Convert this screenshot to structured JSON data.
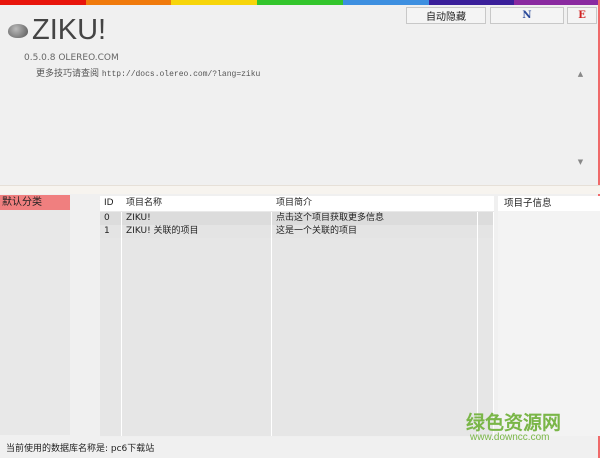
{
  "colors": {
    "rainbow": [
      "#e8150c",
      "#f07a0c",
      "#f7d50a",
      "#33c52c",
      "#3d8fe0",
      "#3a1f9a",
      "#8a2aa0"
    ],
    "accent": "#f07f7f"
  },
  "toolbar": {
    "auto_hide": "自动隐藏",
    "n": "N",
    "e": "E"
  },
  "header": {
    "title": "ZIKU!",
    "version": "0.5.0.8  OLEREO.COM",
    "more_label": "更多技巧请查阅",
    "more_url": "http://docs.olereo.com/?lang=ziku"
  },
  "sidebar": {
    "categories": [
      {
        "label": "默认分类"
      }
    ]
  },
  "table": {
    "headers": [
      "ID",
      "项目名称",
      "项目简介",
      ""
    ],
    "rows": [
      {
        "id": "0",
        "name": "ZIKU!",
        "desc": "点击这个项目获取更多信息"
      },
      {
        "id": "1",
        "name": "ZIKU! 关联的项目",
        "desc": "这是一个关联的项目"
      }
    ]
  },
  "right_panel": {
    "header": "项目子信息"
  },
  "status": {
    "text": "当前使用的数据库名称是: pc6下载站"
  },
  "watermark": {
    "name": "绿色资源网",
    "url": "www.downcc.com"
  }
}
